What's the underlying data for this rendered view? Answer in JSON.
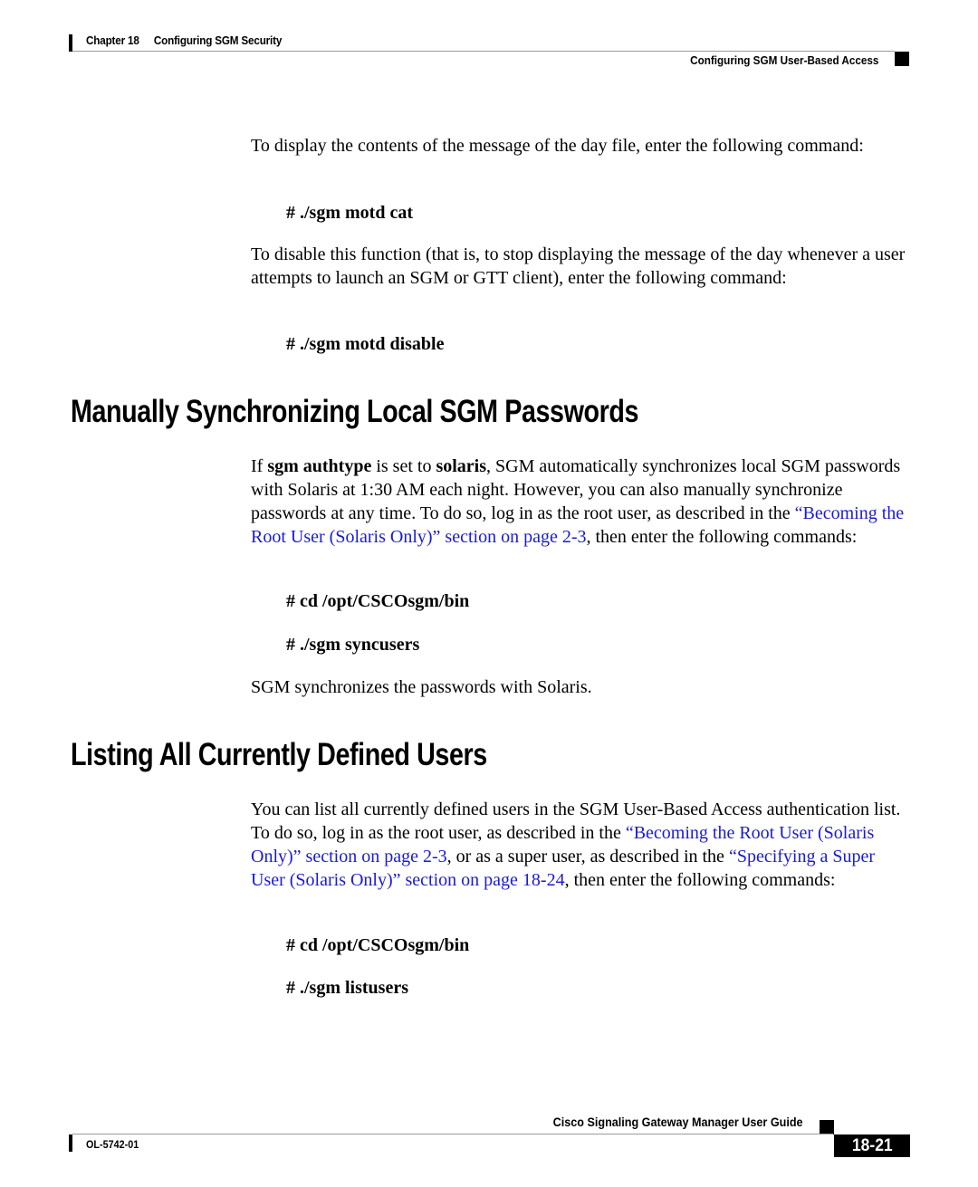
{
  "header": {
    "chapter_label": "Chapter 18",
    "chapter_title": "Configuring SGM Security",
    "section_title": "Configuring SGM User-Based Access"
  },
  "intro": {
    "para1": "To display the contents of the message of the day file, enter the following command:",
    "cmd1": "# ./sgm motd cat",
    "para2": "To disable this function (that is, to stop displaying the message of the day whenever a user attempts to launch an SGM or GTT client), enter the following command:",
    "cmd2": "# ./sgm motd disable"
  },
  "section1": {
    "heading": "Manually Synchronizing Local SGM Passwords",
    "para": {
      "t1": "If ",
      "b1": "sgm authtype",
      "t2": " is set to ",
      "b2": "solaris",
      "t3": ", SGM automatically synchronizes local SGM passwords with Solaris at 1:30 AM each night. However, you can also manually synchronize passwords at any time. To do so, log in as the root user, as described in the ",
      "link1": "“Becoming the Root User (Solaris Only)” section on page 2-3",
      "t4": ", then enter the following commands:"
    },
    "cmd1": "# cd /opt/CSCOsgm/bin",
    "cmd2": "# ./sgm syncusers",
    "result": "SGM synchronizes the passwords with Solaris."
  },
  "section2": {
    "heading": "Listing All Currently Defined Users",
    "para": {
      "t1": "You can list all currently defined users in the SGM User-Based Access authentication list. To do so, log in as the root user, as described in the ",
      "link1": "“Becoming the Root User (Solaris Only)” section on page 2-3",
      "t2": ", or as a super user, as described in the ",
      "link2": "“Specifying a Super User (Solaris Only)” section on page 18-24",
      "t3": ", then enter the following commands:"
    },
    "cmd1": "# cd /opt/CSCOsgm/bin",
    "cmd2": "# ./sgm listusers"
  },
  "footer": {
    "guide_title": "Cisco Signaling Gateway Manager User Guide",
    "doc_number": "OL-5742-01",
    "page_number": "18-21"
  },
  "colors": {
    "link": "#1a1ad6",
    "text": "#000000",
    "rule": "#9a9a9a"
  }
}
